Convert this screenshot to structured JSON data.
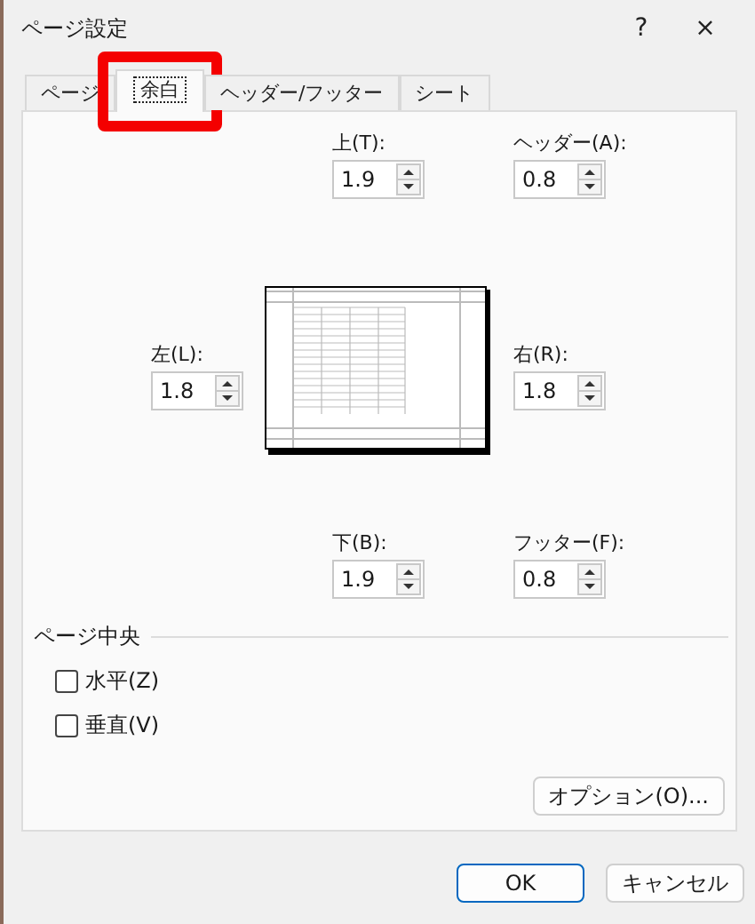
{
  "window": {
    "title": "ページ設定",
    "help": "?",
    "close": "×"
  },
  "tabs": [
    {
      "label": "ページ",
      "selected": false,
      "annotated": false
    },
    {
      "label": "余白",
      "selected": true,
      "annotated": true
    },
    {
      "label": "ヘッダー/フッター",
      "selected": false,
      "annotated": false
    },
    {
      "label": "シート",
      "selected": false,
      "annotated": false
    }
  ],
  "margins": {
    "top": {
      "label": "上(T):",
      "value": "1.9"
    },
    "header": {
      "label": "ヘッダー(A):",
      "value": "0.8"
    },
    "left": {
      "label": "左(L):",
      "value": "1.8"
    },
    "right": {
      "label": "右(R):",
      "value": "1.8"
    },
    "bottom": {
      "label": "下(B):",
      "value": "1.9"
    },
    "footer": {
      "label": "フッター(F):",
      "value": "0.8"
    }
  },
  "center_on_page": {
    "title": "ページ中央",
    "options": [
      {
        "label": "水平(Z)",
        "checked": false
      },
      {
        "label": "垂直(V)",
        "checked": false
      }
    ]
  },
  "options_button": "オプション(O)...",
  "buttons": [
    {
      "label": "OK",
      "kind": "primary"
    },
    {
      "label": "キャンセル",
      "kind": "normal"
    }
  ]
}
